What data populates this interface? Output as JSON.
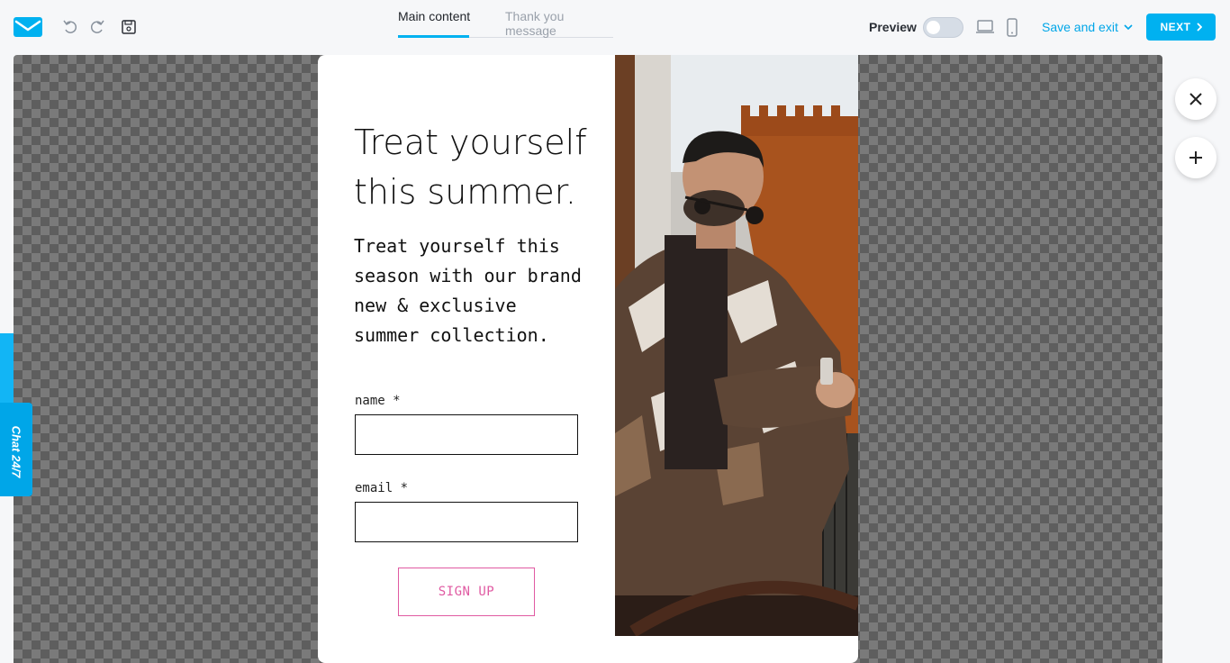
{
  "toolbar": {
    "tabs": [
      {
        "label": "Main content",
        "active": true
      },
      {
        "label": "Thank you message",
        "active": false
      }
    ],
    "preview_label": "Preview",
    "preview_on": false,
    "save_exit_label": "Save and exit",
    "next_label": "NEXT",
    "icons": [
      "undo-icon",
      "redo-icon",
      "save-icon",
      "desktop-icon",
      "mobile-icon"
    ],
    "accent_color": "#00b1f0"
  },
  "popup": {
    "headline": "Treat yourself this summer.",
    "body": "Treat yourself this season with our brand new & exclusive summer collection.",
    "fields": [
      {
        "label": "name *",
        "value": ""
      },
      {
        "label": "email *",
        "value": ""
      }
    ],
    "cta_label": "SIGN UP",
    "cta_color": "#e05aa2",
    "image_subject": "man in sunglasses and fur jacket checking wristwatch"
  },
  "side_actions": [
    "close-icon",
    "add-icon"
  ],
  "chat": {
    "label": "Chat 24/7"
  }
}
